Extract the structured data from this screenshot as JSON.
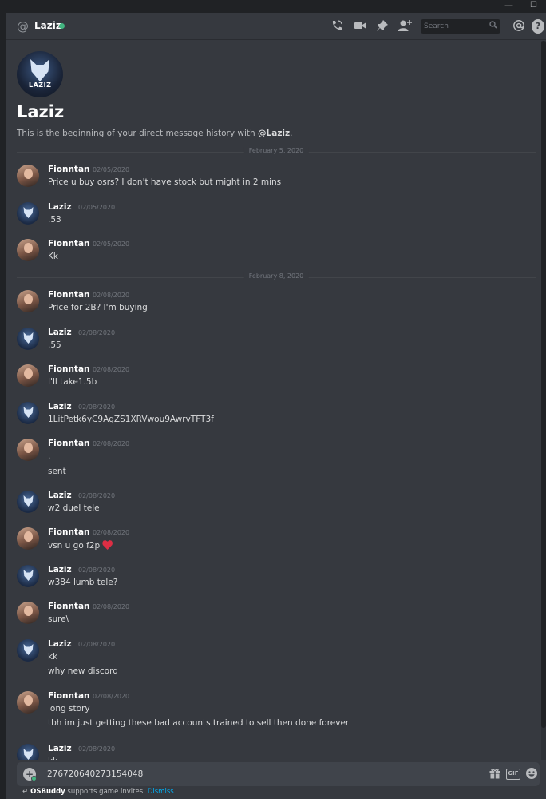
{
  "window": {
    "minimize_glyph": "—",
    "maximize_glyph": "☐"
  },
  "header": {
    "at_symbol": "@",
    "channel_name": "Laziz",
    "status_color": "#43b581",
    "icons": [
      "phone-call-icon",
      "video-icon",
      "pin-icon",
      "add-friend-icon",
      "mention-icon",
      "help-icon"
    ],
    "search_placeholder": "Search",
    "help_glyph": "?"
  },
  "intro": {
    "avatar_tag": "LAZIZ",
    "title": "Laziz",
    "text_prefix": "This is the beginning of your direct message history with ",
    "text_mention": "@Laziz",
    "text_suffix": "."
  },
  "dividers": [
    "February 5, 2020",
    "February 8, 2020"
  ],
  "messages": [
    {
      "author": "Fionntan",
      "time": "02/05/2020",
      "lines": [
        "Price u buy osrs? I don't have stock but might in 2 mins"
      ]
    },
    {
      "author": "Laziz",
      "time": "02/05/2020",
      "lines": [
        ".53"
      ]
    },
    {
      "author": "Fionntan",
      "time": "02/05/2020",
      "lines": [
        "Kk"
      ]
    },
    {
      "author": "Fionntan",
      "time": "02/08/2020",
      "lines": [
        "Price for 2B? I'm buying"
      ]
    },
    {
      "author": "Laziz",
      "time": "02/08/2020",
      "lines": [
        ".55"
      ]
    },
    {
      "author": "Fionntan",
      "time": "02/08/2020",
      "lines": [
        "I'll take1.5b"
      ]
    },
    {
      "author": "Laziz",
      "time": "02/08/2020",
      "lines": [
        "1LitPetk6yC9AgZS1XRVwou9AwrvTFT3f"
      ]
    },
    {
      "author": "Fionntan",
      "time": "02/08/2020",
      "lines": [
        ".",
        "sent"
      ]
    },
    {
      "author": "Laziz",
      "time": "02/08/2020",
      "lines": [
        "w2 duel tele"
      ]
    },
    {
      "author": "Fionntan",
      "time": "02/08/2020",
      "lines": [
        "vsn u go f2p"
      ]
    },
    {
      "author": "Laziz",
      "time": "02/08/2020",
      "lines": [
        "w384 lumb tele?"
      ]
    },
    {
      "author": "Fionntan",
      "time": "02/08/2020",
      "lines": [
        "sure\\"
      ]
    },
    {
      "author": "Laziz",
      "time": "02/08/2020",
      "lines": [
        "kk",
        "why new discord"
      ]
    },
    {
      "author": "Fionntan",
      "time": "02/08/2020",
      "lines": [
        "long story",
        "tbh im just getting these bad accounts trained to sell then done forever"
      ]
    },
    {
      "author": "Laziz",
      "time": "02/08/2020",
      "lines": [
        "kk"
      ]
    }
  ],
  "emoji": {
    "heart": "heart-emoji",
    "color": "#dd2e44"
  },
  "composer": {
    "value": "276720640273154048",
    "icons": [
      "attach-plus-icon",
      "gift-icon",
      "gif-icon",
      "emoji-icon"
    ],
    "gif_label": "GIF"
  },
  "notice": {
    "app_name": "OSBuddy",
    "text": " supports game invites.",
    "dismiss_label": "Dismiss"
  }
}
